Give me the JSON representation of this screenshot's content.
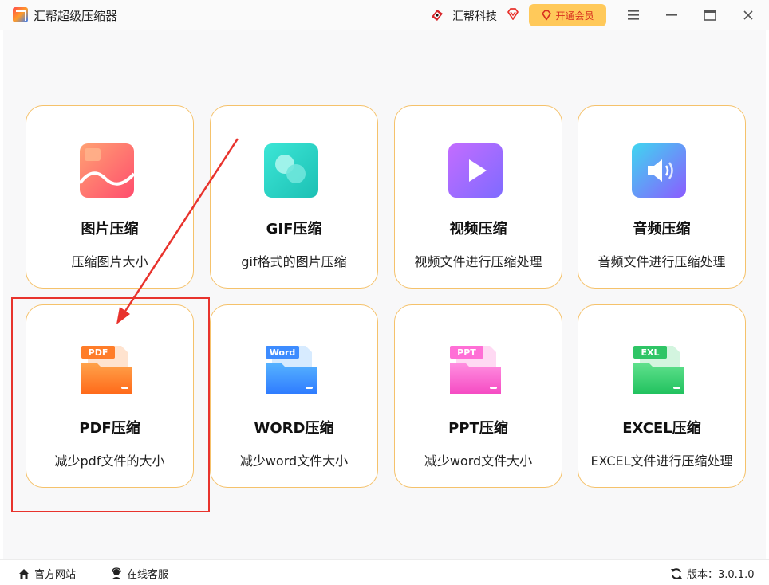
{
  "titlebar": {
    "app_title": "汇帮超级压缩器",
    "brand_name": "汇帮科技",
    "vip_label": "开通会员"
  },
  "cards": [
    {
      "title": "图片压缩",
      "desc": "压缩图片大小",
      "icon": "image-icon"
    },
    {
      "title": "GIF压缩",
      "desc": "gif格式的图片压缩",
      "icon": "gif-icon"
    },
    {
      "title": "视频压缩",
      "desc": "视频文件进行压缩处理",
      "icon": "video-icon"
    },
    {
      "title": "音频压缩",
      "desc": "音频文件进行压缩处理",
      "icon": "audio-icon"
    },
    {
      "title": "PDF压缩",
      "desc": "减少pdf文件的大小",
      "icon": "pdf-icon",
      "badge": "PDF"
    },
    {
      "title": "WORD压缩",
      "desc": "减少word文件大小",
      "icon": "word-icon",
      "badge": "Word"
    },
    {
      "title": "PPT压缩",
      "desc": "减少word文件大小",
      "icon": "ppt-icon",
      "badge": "PPT"
    },
    {
      "title": "EXCEL压缩",
      "desc": "EXCEL文件进行压缩处理",
      "icon": "excel-icon",
      "badge": "EXL"
    }
  ],
  "footer": {
    "website_label": "官方网站",
    "service_label": "在线客服",
    "version_label": "版本：3.0.1.0"
  },
  "colors": {
    "card_border": "#f5c26b",
    "vip_bg": "#ffc95a",
    "annotation_red": "#e8332d"
  }
}
